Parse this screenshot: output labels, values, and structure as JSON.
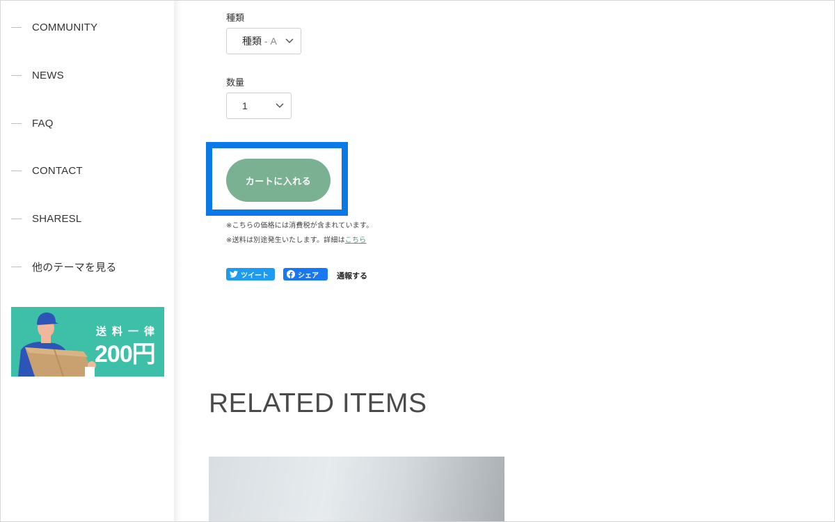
{
  "sidebar": {
    "items": [
      {
        "label": "COMMUNITY"
      },
      {
        "label": "NEWS"
      },
      {
        "label": "FAQ"
      },
      {
        "label": "CONTACT"
      },
      {
        "label": "SHARESL"
      },
      {
        "label": "他のテーマを見る"
      }
    ],
    "banner": {
      "line1": "送料一律",
      "line2": "200円"
    }
  },
  "product": {
    "variant_label": "種類",
    "variant_value": "種類",
    "variant_suffix": " - A",
    "quantity_label": "数量",
    "quantity_value": "1",
    "add_to_cart": "カートに入れる",
    "tax_note": "※こちらの価格には消費税が含まれています。",
    "shipping_note": "※送料は別途発生いたします。詳細は",
    "shipping_link": "こちら"
  },
  "share": {
    "tweet": "ツイート",
    "facebook": "シェア",
    "report": "通報する"
  },
  "related": {
    "title": "RELATED ITEMS"
  },
  "colors": {
    "highlight": "#0a78e6",
    "cart_button": "#7bb193",
    "banner": "#3ebfa8",
    "twitter": "#1d9bf0",
    "facebook": "#1877f2"
  }
}
